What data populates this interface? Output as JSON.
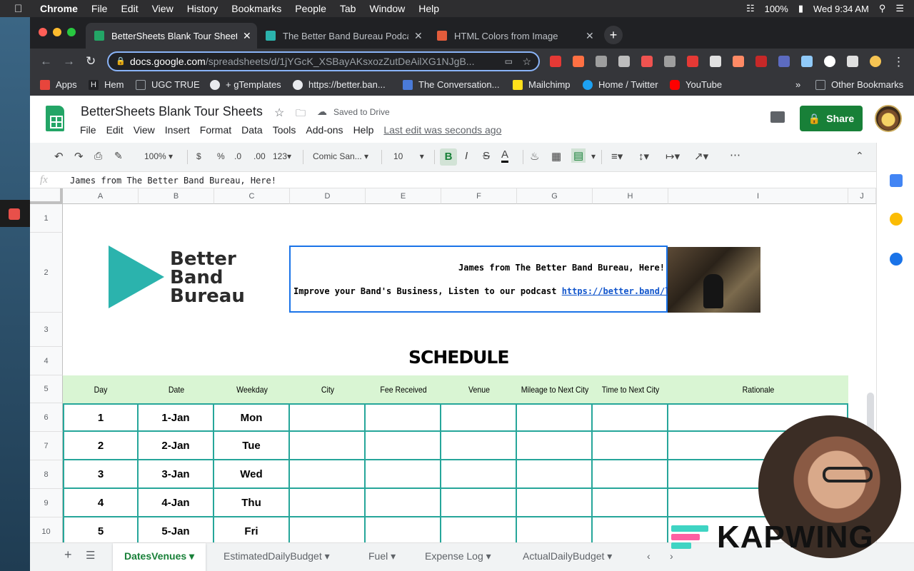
{
  "menubar": {
    "app": "Chrome",
    "items": [
      "File",
      "Edit",
      "View",
      "History",
      "Bookmarks",
      "People",
      "Tab",
      "Window",
      "Help"
    ],
    "battery": "100%",
    "clock": "Wed 9:34 AM"
  },
  "browser": {
    "tabs": [
      {
        "title": "BetterSheets Blank Tour Sheet",
        "color": "#23a566"
      },
      {
        "title": "The Better Band Bureau Podca",
        "color": "#2bb3ad"
      },
      {
        "title": "HTML Colors from Image",
        "color": "#e25c3b"
      }
    ],
    "url_host": "docs.google.com",
    "url_path": "/spreadsheets/d/1jYGcK_XSBayAKsxozZutDeAilXG1NJgB...",
    "bookmarks": [
      {
        "label": "Apps",
        "color": "#e8453c"
      },
      {
        "label": "Hem",
        "color": "#202124"
      },
      {
        "label": "UGC TRUE",
        "color": "#9aa0a6"
      },
      {
        "label": "+ gTemplates",
        "color": "#e8eaed"
      },
      {
        "label": "https://better.ban...",
        "color": "#e8eaed"
      },
      {
        "label": "The Conversation...",
        "color": "#4a7bd8"
      },
      {
        "label": "Mailchimp",
        "color": "#ffe01b"
      },
      {
        "label": "Home / Twitter",
        "color": "#1da1f2"
      },
      {
        "label": "YouTube",
        "color": "#ff0000"
      },
      {
        "label": "Other Bookmarks",
        "color": "#9aa0a6"
      }
    ],
    "more_bookmarks": "»"
  },
  "sheets": {
    "title": "BetterSheets Blank Tour Sheets",
    "saved": "Saved to Drive",
    "menu": [
      "File",
      "Edit",
      "View",
      "Insert",
      "Format",
      "Data",
      "Tools",
      "Add-ons",
      "Help"
    ],
    "last_edit": "Last edit was seconds ago",
    "share_label": "Share",
    "zoom": "100%",
    "currency": "$",
    "percent": "%",
    "dec_less": ".0",
    "dec_more": ".00",
    "number_fmt": "123",
    "font": "Comic San...",
    "font_size": "10",
    "formula_value": "James from The Better Band Bureau, Here!",
    "columns": [
      "A",
      "B",
      "C",
      "D",
      "E",
      "F",
      "G",
      "H",
      "I",
      "J"
    ],
    "rows": [
      "1",
      "2",
      "3",
      "4",
      "5",
      "6",
      "7",
      "8",
      "9",
      "10"
    ],
    "logo_lines": [
      "Better",
      "Band",
      "Bureau"
    ],
    "info_line1": "James from The Better Band Bureau, Here!",
    "info_line2": "Improve your Band's Business, Listen to our podcast",
    "info_link": "https://better.band/listen",
    "schedule_title": "SCHEDULE",
    "headers": [
      "Day",
      "Date",
      "Weekday",
      "City",
      "Fee Received",
      "Venue",
      "Mileage to Next City",
      "Time to Next City",
      "Rationale"
    ],
    "days": [
      {
        "day": "1",
        "date": "1-Jan",
        "weekday": "Mon"
      },
      {
        "day": "2",
        "date": "2-Jan",
        "weekday": "Tue"
      },
      {
        "day": "3",
        "date": "3-Jan",
        "weekday": "Wed"
      },
      {
        "day": "4",
        "date": "4-Jan",
        "weekday": "Thu"
      },
      {
        "day": "5",
        "date": "5-Jan",
        "weekday": "Fri"
      }
    ],
    "sheet_tabs": [
      "DatesVenues",
      "EstimatedDailyBudget",
      "Fuel",
      "Expense Log",
      "ActualDailyBudget"
    ],
    "accent_color": "#188038",
    "header_fill": "#d9f5d3",
    "border_color": "#26a69a"
  },
  "overlay": {
    "brand": "KAPWING"
  }
}
